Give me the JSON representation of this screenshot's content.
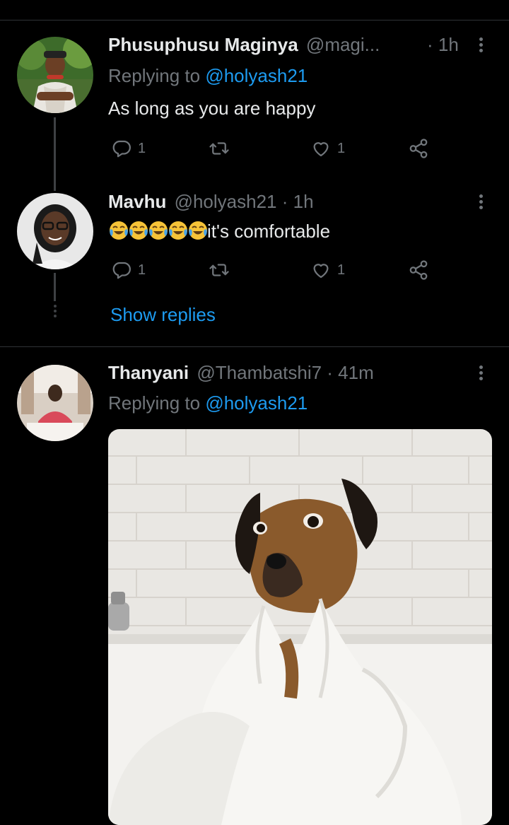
{
  "tweets": [
    {
      "name": "Phusuphusu Maginya",
      "handle": "@magi...",
      "time": "· 1h",
      "replying_prefix": "Replying to ",
      "replying_handle": "@holyash21",
      "text": "As long as you are happy",
      "replies": "1",
      "retweets": "",
      "likes": "1"
    },
    {
      "name": "Mavhu",
      "handle": "@holyash21 · 1h",
      "emoji_count": 5,
      "text": "it's comfortable",
      "replies": "1",
      "retweets": "",
      "likes": "1",
      "show_replies": "Show replies"
    },
    {
      "name": "Thanyani",
      "handle": "@Thambatshi7 · 41m",
      "replying_prefix": "Replying to ",
      "replying_handle": "@holyash21"
    }
  ],
  "icons": [
    "reply-icon",
    "retweet-icon",
    "like-icon",
    "share-icon",
    "more-icon",
    "laughing-emoji-icon"
  ],
  "colors": {
    "background": "#000000",
    "text": "#e7e9ea",
    "muted": "#71767b",
    "link": "#1d9bf0",
    "divider": "#2f3336"
  }
}
